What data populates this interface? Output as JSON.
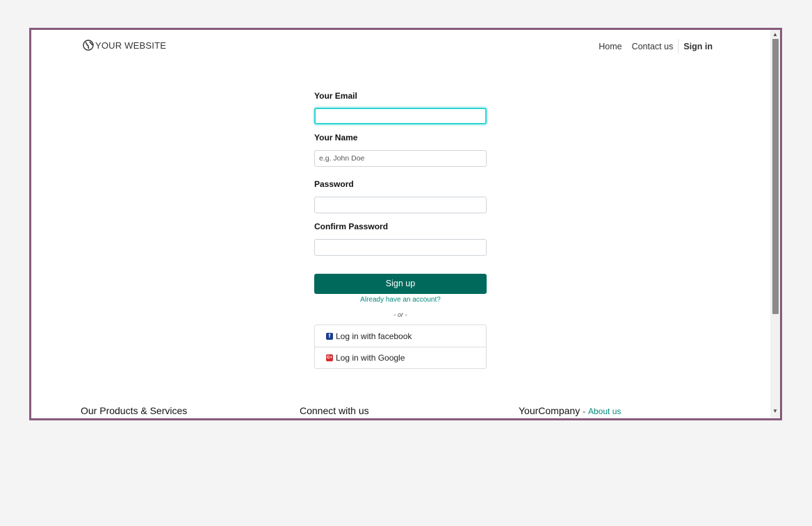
{
  "header": {
    "brand": "YOUR WEBSITE",
    "nav": {
      "home": "Home",
      "contact": "Contact us",
      "signin": "Sign in"
    }
  },
  "form": {
    "email_label": "Your Email",
    "email_value": "",
    "name_label": "Your Name",
    "name_placeholder": "e.g. John Doe",
    "password_label": "Password",
    "confirm_label": "Confirm Password",
    "signup_button": "Sign up",
    "account_link": "Already have an account?",
    "or_text": "- or -",
    "facebook_login": "Log in with facebook",
    "google_login": "Log in with Google"
  },
  "footer": {
    "col1_title": "Our Products & Services",
    "col2_title": "Connect with us",
    "col3_title": "YourCompany",
    "col3_separator": "-",
    "col3_link": "About us"
  },
  "colors": {
    "frame_border": "#875a7b",
    "primary": "#00695c",
    "link": "#00897b",
    "focus_ring": "#2fd3d3"
  }
}
